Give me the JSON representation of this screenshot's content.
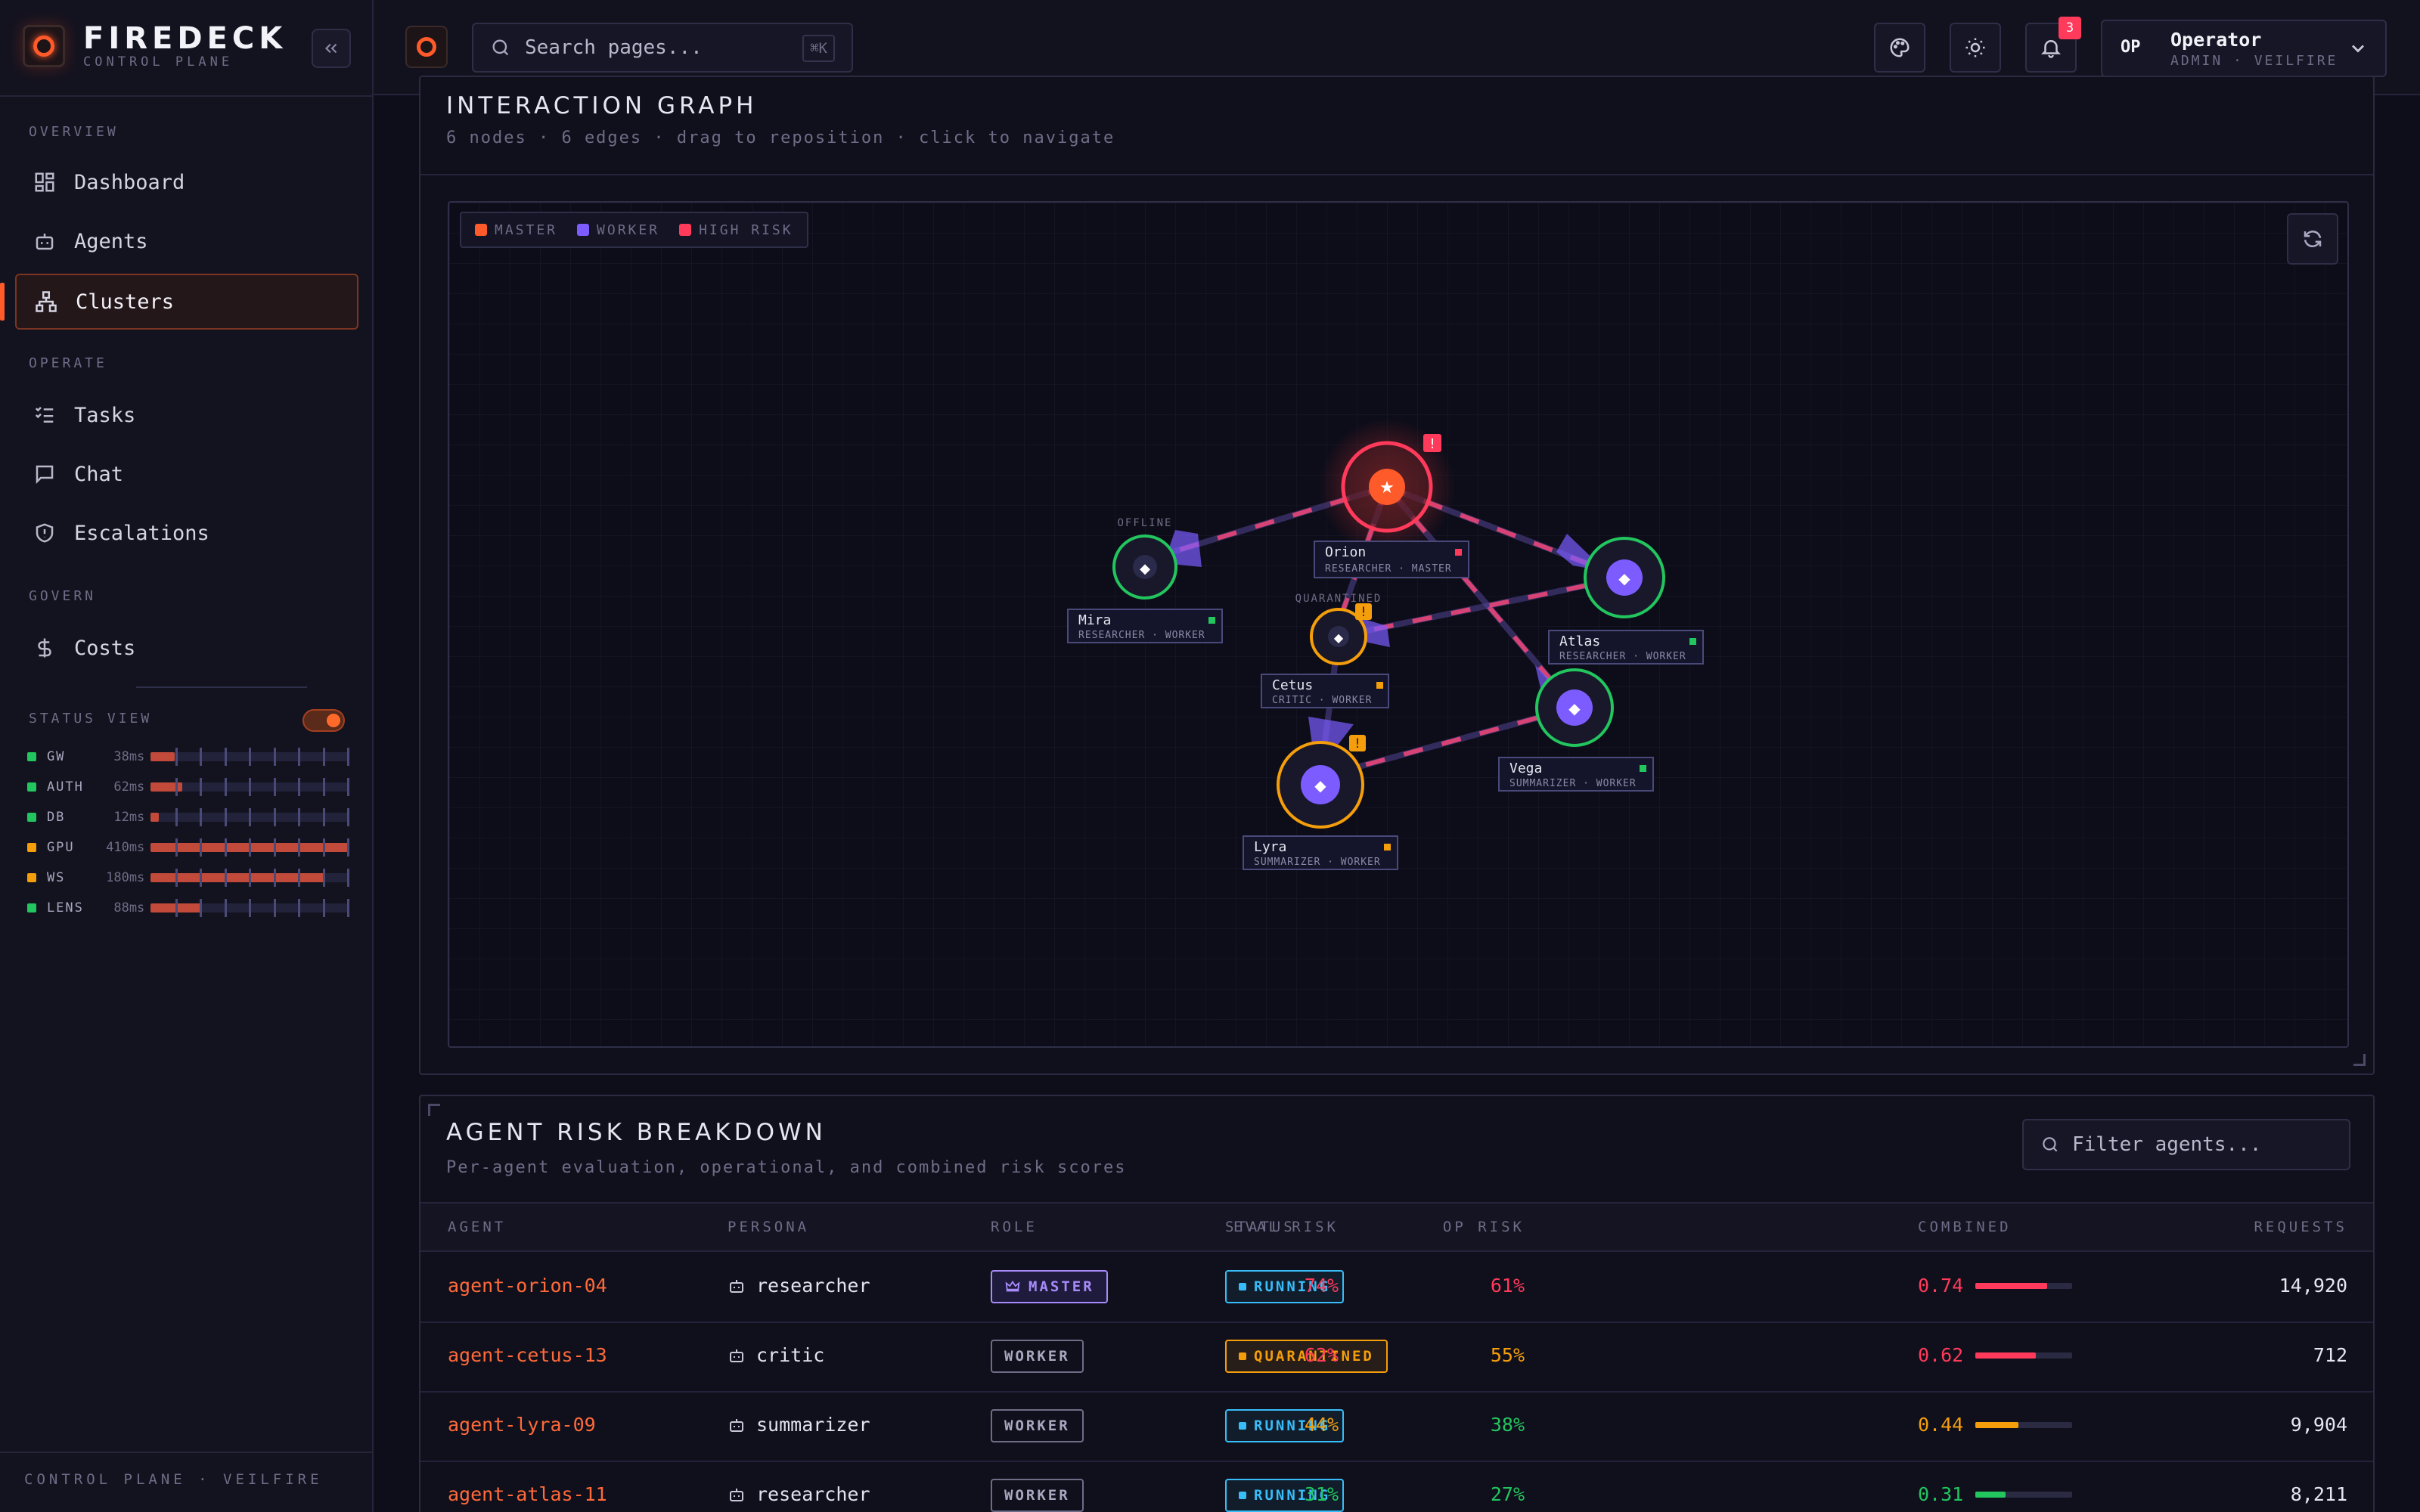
{
  "brand": {
    "name": "FIREDECK",
    "sub": "CONTROL PLANE"
  },
  "sidebar": {
    "sections": [
      {
        "label": "OVERVIEW",
        "items": [
          {
            "label": "Dashboard",
            "icon": "dashboard-icon"
          },
          {
            "label": "Agents",
            "icon": "robot-icon"
          },
          {
            "label": "Clusters",
            "icon": "cluster-icon",
            "active": true
          }
        ]
      },
      {
        "label": "OPERATE",
        "items": [
          {
            "label": "Tasks",
            "icon": "tasks-icon"
          },
          {
            "label": "Chat",
            "icon": "chat-icon"
          },
          {
            "label": "Escalations",
            "icon": "shield-icon"
          }
        ]
      },
      {
        "label": "GOVERN",
        "items": [
          {
            "label": "Costs",
            "icon": "dollar-icon"
          }
        ]
      }
    ],
    "status_view": {
      "label": "STATUS VIEW",
      "enabled": true,
      "services": [
        {
          "name": "GW",
          "latency": "38ms",
          "color": "#22c55e",
          "load": 0.12
        },
        {
          "name": "AUTH",
          "latency": "62ms",
          "color": "#22c55e",
          "load": 0.16
        },
        {
          "name": "DB",
          "latency": "12ms",
          "color": "#22c55e",
          "load": 0.04
        },
        {
          "name": "GPU",
          "latency": "410ms",
          "color": "#f59e0b",
          "load": 1.0
        },
        {
          "name": "WS",
          "latency": "180ms",
          "color": "#f59e0b",
          "load": 0.88
        },
        {
          "name": "LENS",
          "latency": "88ms",
          "color": "#22c55e",
          "load": 0.26
        }
      ]
    },
    "footer": "CONTROL PLANE · VEILFIRE"
  },
  "topbar": {
    "search_placeholder": "Search pages...",
    "search_shortcut": "⌘K",
    "notification_count": "3",
    "user": {
      "initials": "OP",
      "name": "Operator",
      "role": "ADMIN · VEILFIRE"
    }
  },
  "graph": {
    "title": "INTERACTION GRAPH",
    "subtitle": "6 nodes · 6 edges · drag to reposition · click to navigate",
    "legend": [
      {
        "label": "MASTER",
        "color": "#ff5a2a"
      },
      {
        "label": "WORKER",
        "color": "#7c5cff"
      },
      {
        "label": "HIGH RISK",
        "color": "#ff3a5a"
      }
    ],
    "nodes": [
      {
        "name": "Orion",
        "desc": "RESEARCHER · MASTER",
        "tag": "",
        "warn": "!",
        "kind": "master"
      },
      {
        "name": "Mira",
        "desc": "RESEARCHER · WORKER",
        "tag": "OFFLINE",
        "warn": "",
        "kind": "worker"
      },
      {
        "name": "Cetus",
        "desc": "CRITIC · WORKER",
        "tag": "QUARANTINED",
        "warn": "!",
        "kind": "worker"
      },
      {
        "name": "Atlas",
        "desc": "RESEARCHER · WORKER",
        "tag": "",
        "warn": "",
        "kind": "worker"
      },
      {
        "name": "Vega",
        "desc": "SUMMARIZER · WORKER",
        "tag": "",
        "warn": "",
        "kind": "worker"
      },
      {
        "name": "Lyra",
        "desc": "SUMMARIZER · WORKER",
        "tag": "",
        "warn": "!",
        "kind": "worker"
      }
    ]
  },
  "risk": {
    "title": "AGENT RISK BREAKDOWN",
    "subtitle": "Per-agent evaluation, operational, and combined risk scores",
    "filter_placeholder": "Filter agents...",
    "columns": [
      "AGENT",
      "PERSONA",
      "ROLE",
      "STATUS",
      "EVAL RISK",
      "OP RISK",
      "COMBINED",
      "REQUESTS"
    ],
    "rows": [
      {
        "agent": "agent-orion-04",
        "persona": "researcher",
        "role": "MASTER",
        "status": "RUNNING",
        "eval": "74%",
        "op": "61%",
        "combined": "0.74",
        "combined_value": 0.74,
        "requests": "14,920"
      },
      {
        "agent": "agent-cetus-13",
        "persona": "critic",
        "role": "WORKER",
        "status": "QUARANTINED",
        "eval": "62%",
        "op": "55%",
        "combined": "0.62",
        "combined_value": 0.62,
        "requests": "712"
      },
      {
        "agent": "agent-lyra-09",
        "persona": "summarizer",
        "role": "WORKER",
        "status": "RUNNING",
        "eval": "44%",
        "op": "38%",
        "combined": "0.44",
        "combined_value": 0.44,
        "requests": "9,904"
      },
      {
        "agent": "agent-atlas-11",
        "persona": "researcher",
        "role": "WORKER",
        "status": "RUNNING",
        "eval": "31%",
        "op": "27%",
        "combined": "0.31",
        "combined_value": 0.31,
        "requests": "8,211"
      }
    ]
  },
  "colors": {
    "accent": "#ff5a2a",
    "master": "#a78bfa",
    "running": "#38bdf8",
    "quarantined": "#f59e0b",
    "high": "#ff3a5a",
    "mid": "#f59e0b",
    "low": "#22c55e"
  }
}
